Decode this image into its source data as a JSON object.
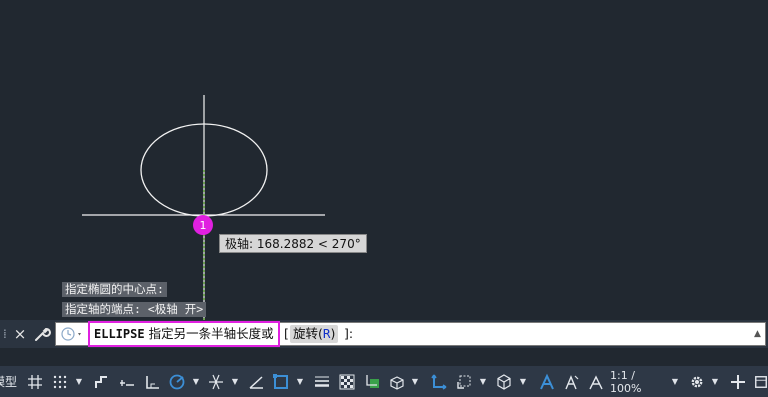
{
  "canvas": {
    "background": "#212830",
    "ellipse_color": "#f2f2f2",
    "axis_color": "#f2f2f2",
    "polar_track_color": "#7fd24a",
    "snap_marker_color": "#e020e0",
    "snap_marker_label": "1"
  },
  "command_history": [
    "指定椭圆的中心点:",
    "指定轴的端点: <极轴 开>"
  ],
  "tooltip": {
    "text": "极轴: 168.2882 < 270°"
  },
  "command_line": {
    "close_icon": "×",
    "grip_icon": "grip-icon",
    "command_name": "ELLIPSE",
    "prompt": "指定另一条半轴长度或",
    "bracket_open": "[",
    "option_label": "旋转",
    "option_key_open": "(",
    "option_key": "R",
    "option_key_close": ")",
    "tail": "]:",
    "highlight_color": "#e020e0"
  },
  "status_bar": {
    "model_label": "模型",
    "scale_label": "1:1 / 100%",
    "active_color": "#3c8fd6"
  }
}
